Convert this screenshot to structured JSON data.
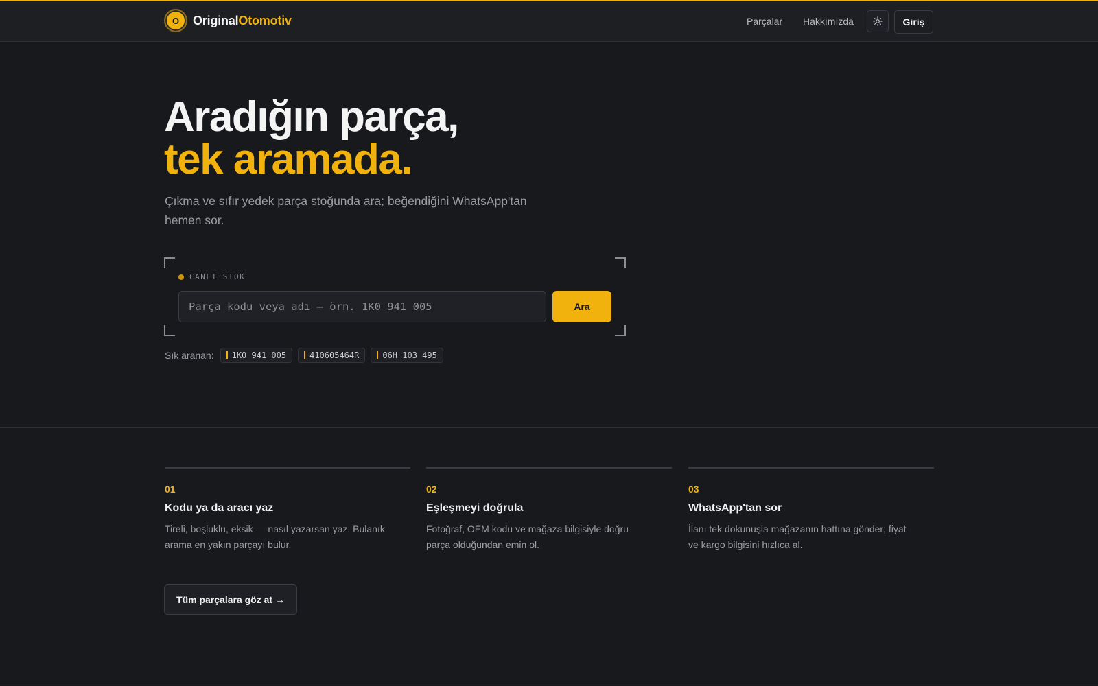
{
  "brand": {
    "name_part1": "Original",
    "name_part2": "Otomotiv",
    "badge_letter": "O"
  },
  "colors": {
    "accent": "#f2b20d",
    "background": "#18191d",
    "header": "#1e1f23"
  },
  "nav": {
    "links": [
      "Parçalar",
      "Hakkımızda"
    ],
    "theme_icon": "sun-icon",
    "login_label": "Giriş"
  },
  "hero": {
    "title_line1": "Aradığın parça,",
    "title_line2": "tek aramada.",
    "subtitle": "Çıkma ve sıfır yedek parça stoğunda ara; beğendiğini WhatsApp'tan hemen sor."
  },
  "search": {
    "live_label": "CANLI STOK",
    "placeholder": "Parça kodu veya adı — örn. 1K0 941 005",
    "value": "",
    "button_label": "Ara"
  },
  "frequent": {
    "label": "Sık aranan:",
    "items": [
      "1K0 941 005",
      "410605464R",
      "06H 103 495"
    ]
  },
  "steps": [
    {
      "num": "01",
      "title": "Kodu ya da aracı yaz",
      "desc": "Tireli, boşluklu, eksik — nasıl yazarsan yaz. Bulanık arama en yakın parçayı bulur."
    },
    {
      "num": "02",
      "title": "Eşleşmeyi doğrula",
      "desc": "Fotoğraf, OEM kodu ve mağaza bilgisiyle doğru parça olduğundan emin ol."
    },
    {
      "num": "03",
      "title": "WhatsApp'tan sor",
      "desc": "İlanı tek dokunuşla mağazanın hattına gönder; fiyat ve kargo bilgisini hızlıca al."
    }
  ],
  "browse_all_label": "Tüm parçalara göz at →"
}
